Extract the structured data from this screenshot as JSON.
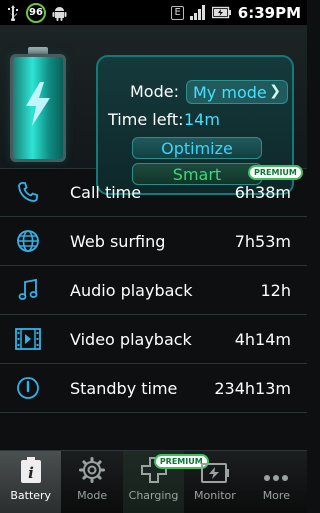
{
  "statusbar": {
    "badge": "96",
    "network": "E",
    "time": "6:39PM"
  },
  "header": {
    "mode_label": "Mode:",
    "mode_value": "My mode",
    "time_left_label": "Time left:",
    "time_left_value": "14m",
    "optimize_label": "Optimize",
    "smart_label": "Smart",
    "premium_badge": "PREMIUM"
  },
  "list": [
    {
      "icon": "phone-icon",
      "label": "Call time",
      "value": "6h38m"
    },
    {
      "icon": "globe-icon",
      "label": "Web surfing",
      "value": "7h53m"
    },
    {
      "icon": "music-note-icon",
      "label": "Audio playback",
      "value": "12h"
    },
    {
      "icon": "film-icon",
      "label": "Video playback",
      "value": "4h14m"
    },
    {
      "icon": "power-icon",
      "label": "Standby time",
      "value": "234h13m"
    }
  ],
  "navbar": {
    "items": [
      {
        "icon": "battery-info-icon",
        "label": "Battery",
        "active": true
      },
      {
        "icon": "gear-icon",
        "label": "Mode"
      },
      {
        "icon": "plus-icon",
        "label": "Charging",
        "premium": "PREMIUM"
      },
      {
        "icon": "monitor-icon",
        "label": "Monitor"
      },
      {
        "icon": "more-dots-icon",
        "label": "More"
      }
    ]
  },
  "colors": {
    "accent": "#44e0ff",
    "teal": "#127a78",
    "green": "#3fd87a"
  }
}
